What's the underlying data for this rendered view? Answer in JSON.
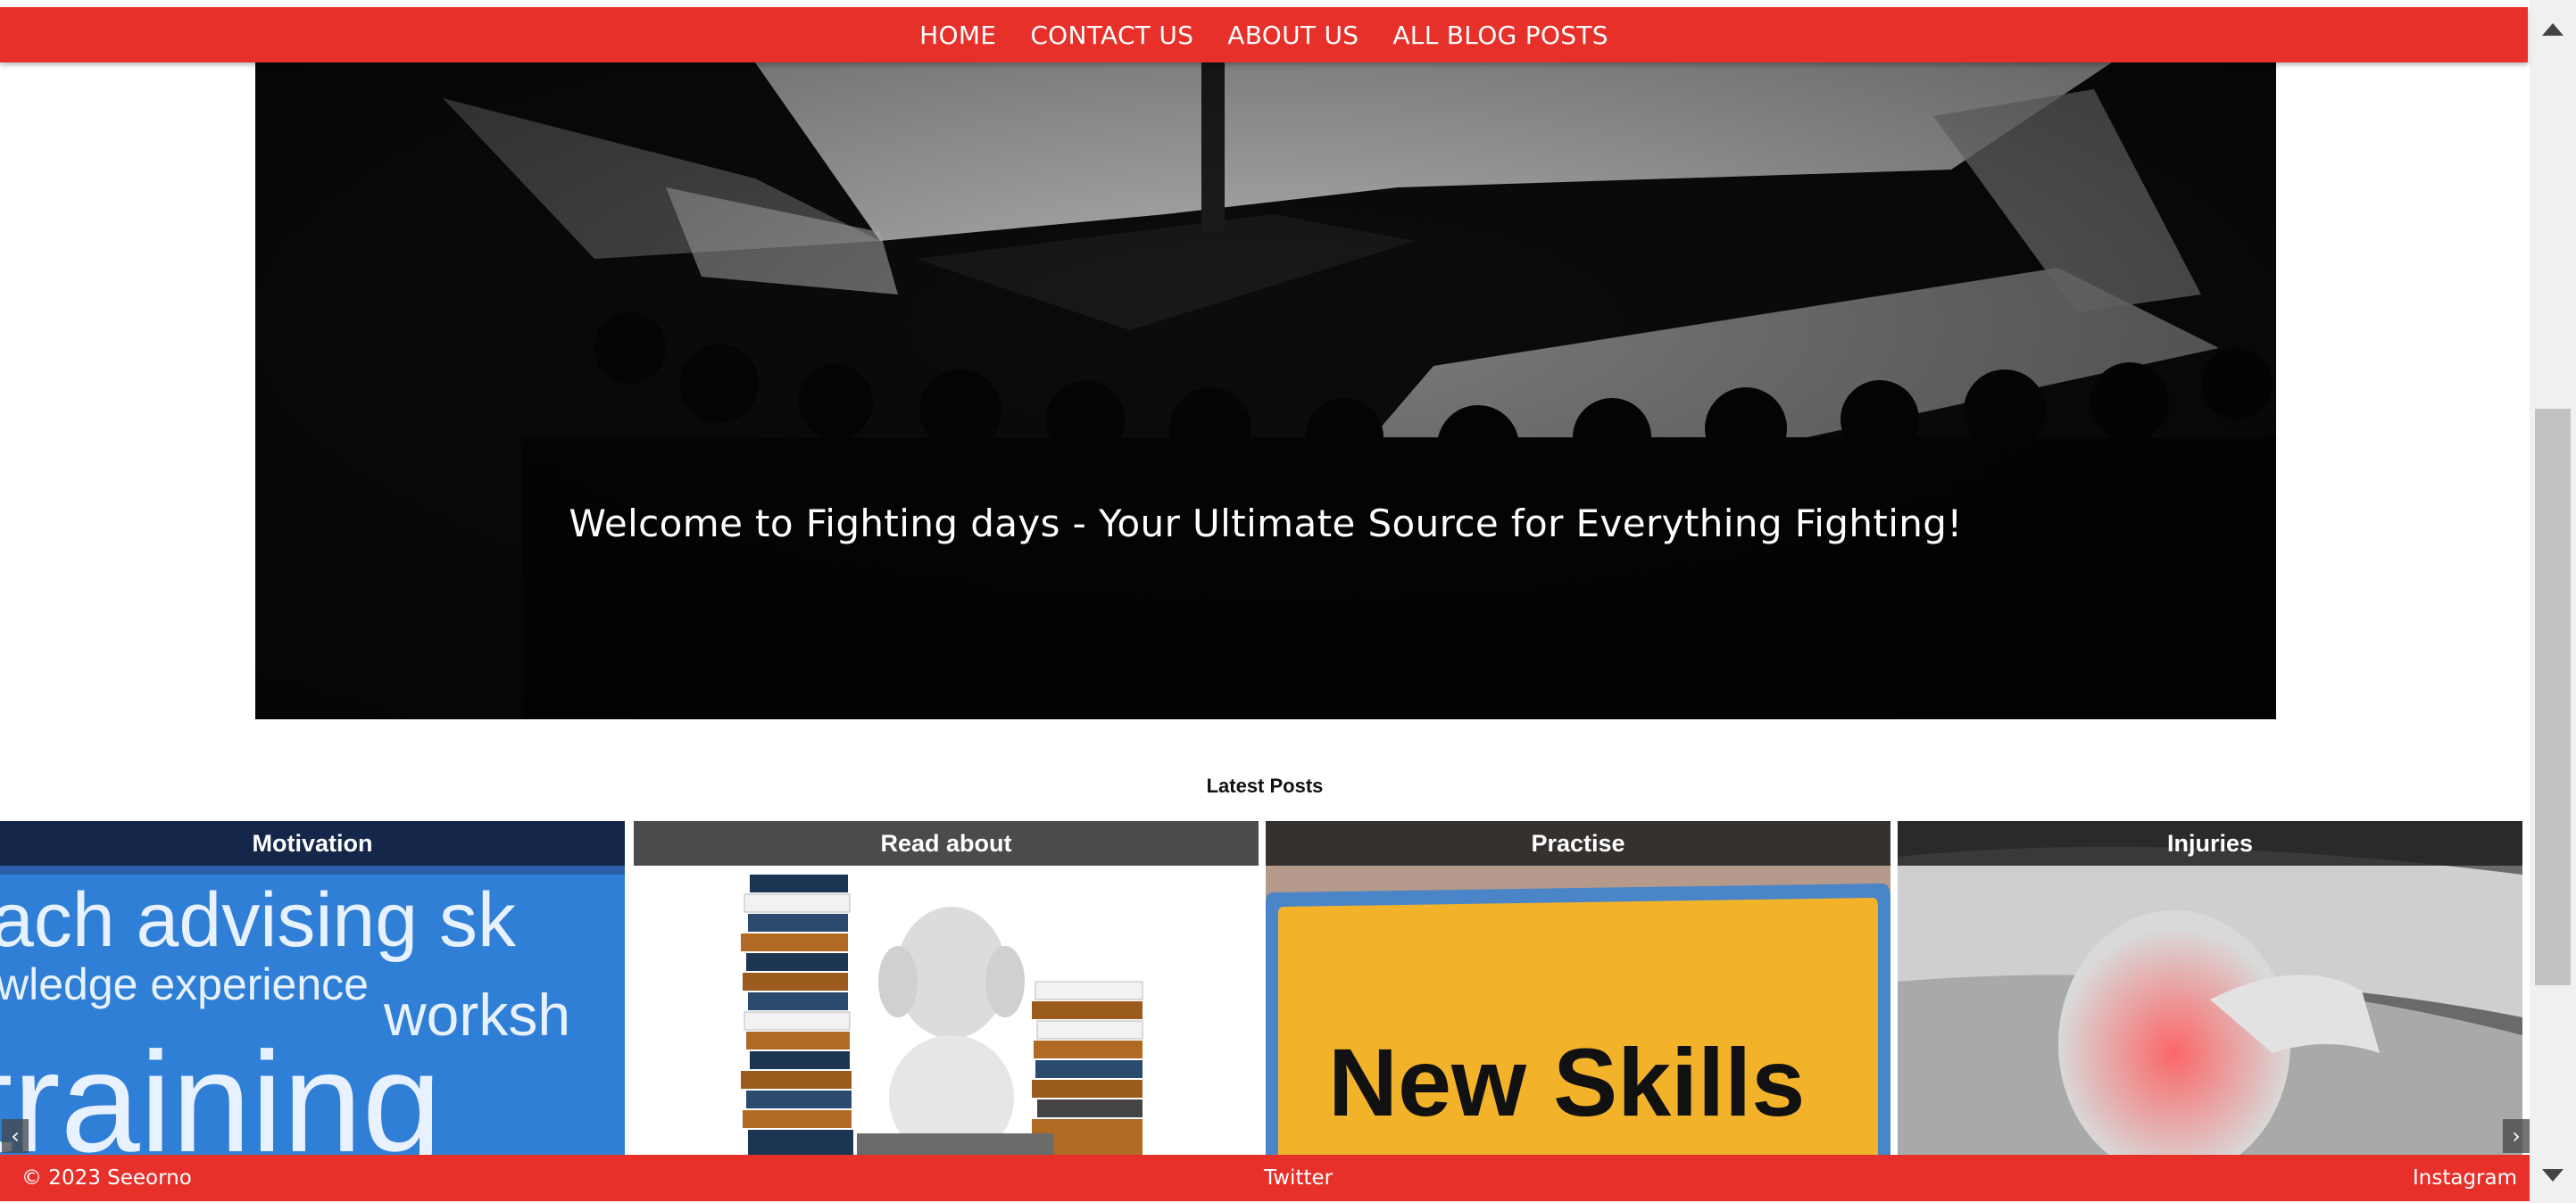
{
  "nav": {
    "items": [
      {
        "label": "HOME"
      },
      {
        "label": "CONTACT US"
      },
      {
        "label": "ABOUT US"
      },
      {
        "label": "ALL BLOG POSTS"
      }
    ]
  },
  "hero": {
    "text": "Welcome to Fighting days - Your Ultimate Source for Everything Fighting!"
  },
  "latest_posts": {
    "heading": "Latest Posts",
    "cards": [
      {
        "title": "Motivation",
        "image_words": [
          "ach advising sk",
          "wledge experience",
          "worksh",
          "training"
        ]
      },
      {
        "title": "Read about"
      },
      {
        "title": "Practise",
        "sign_text": "New Skills"
      },
      {
        "title": "Injuries"
      }
    ],
    "prev_label": "‹",
    "next_label": "›"
  },
  "footer": {
    "copyright": "© 2023 Seeorno",
    "twitter": "Twitter",
    "instagram": "Instagram"
  },
  "colors": {
    "brand_red": "#e8302a",
    "card_title_bg": "#3c3c3c"
  }
}
